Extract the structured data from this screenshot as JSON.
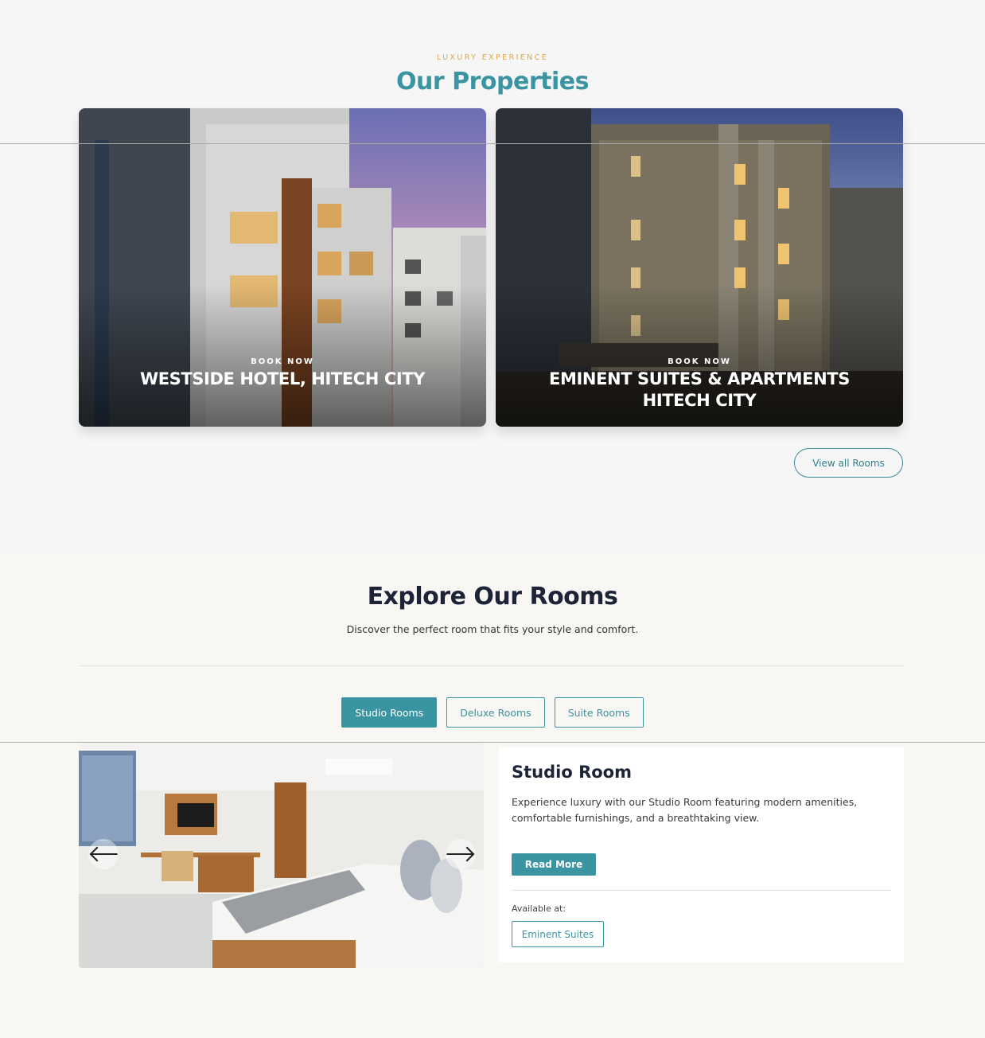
{
  "properties": {
    "eyebrow": "LUXURY EXPERIENCE",
    "title": "Our Properties",
    "cards": [
      {
        "book_label": "BOOK NOW",
        "name": "WESTSIDE HOTEL, HITECH CITY"
      },
      {
        "book_label": "BOOK NOW",
        "name": "EMINENT SUITES & APARTMENTS HITECH CITY"
      }
    ],
    "view_all_label": "View all Rooms"
  },
  "rooms": {
    "title": "Explore Our Rooms",
    "subtitle": "Discover the perfect room that fits your style and comfort.",
    "tabs": [
      {
        "label": "Studio Rooms",
        "active": true
      },
      {
        "label": "Deluxe Rooms",
        "active": false
      },
      {
        "label": "Suite Rooms",
        "active": false
      }
    ],
    "featured": {
      "name": "Studio Room",
      "description": "Experience luxury with our Studio Room featuring modern amenities, comfortable furnishings, and a breathtaking view.",
      "read_more_label": "Read More",
      "available_label": "Available at:",
      "location_label": "Eminent Suites"
    },
    "carousel": {
      "prev_icon": "arrow-left-icon",
      "next_icon": "arrow-right-icon"
    }
  },
  "colors": {
    "accent": "#3b94a1",
    "eyebrow": "#e0a84a",
    "heading": "#1d2437"
  }
}
